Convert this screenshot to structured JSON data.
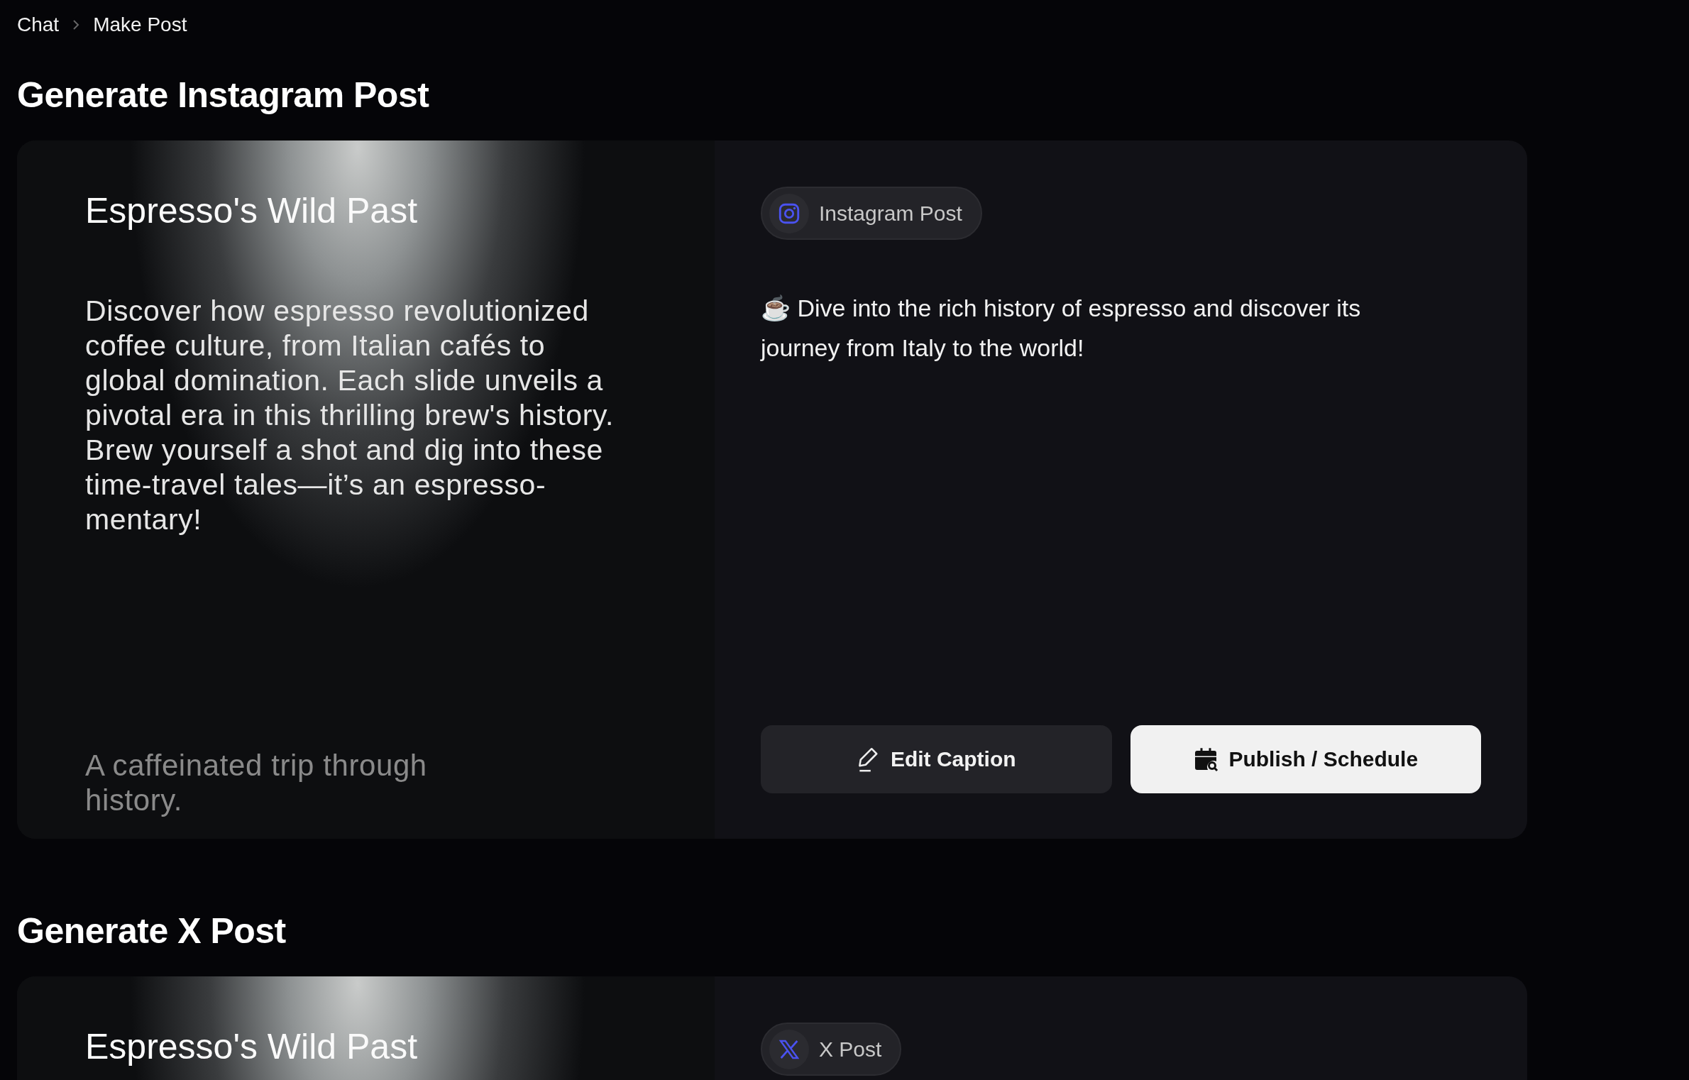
{
  "breadcrumb": [
    {
      "label": "Chat"
    },
    {
      "label": "Make Post"
    }
  ],
  "sections": [
    {
      "kind": "instagram",
      "heading": "Generate Instagram Post",
      "slide": {
        "title": "Espresso's Wild Past",
        "body": "Discover how espresso revolutionized coffee culture, from Italian cafés to global domination. Each slide unveils a pivotal era in this thrilling brew's history. Brew yourself a shot and dig into these time-travel tales—it’s an espresso-mentary!",
        "tagline": "A caffeinated trip through history."
      },
      "badge": "Instagram Post",
      "caption": "☕ Dive into the rich history of espresso and discover its journey from Italy to the world!",
      "buttons": [
        {
          "kind": "edit",
          "label": "Edit Caption"
        },
        {
          "kind": "publish",
          "label": "Publish / Schedule"
        }
      ]
    },
    {
      "kind": "x",
      "heading": "Generate X Post",
      "slide": {
        "title": "Espresso's Wild Past"
      },
      "badge": "X Post"
    }
  ]
}
